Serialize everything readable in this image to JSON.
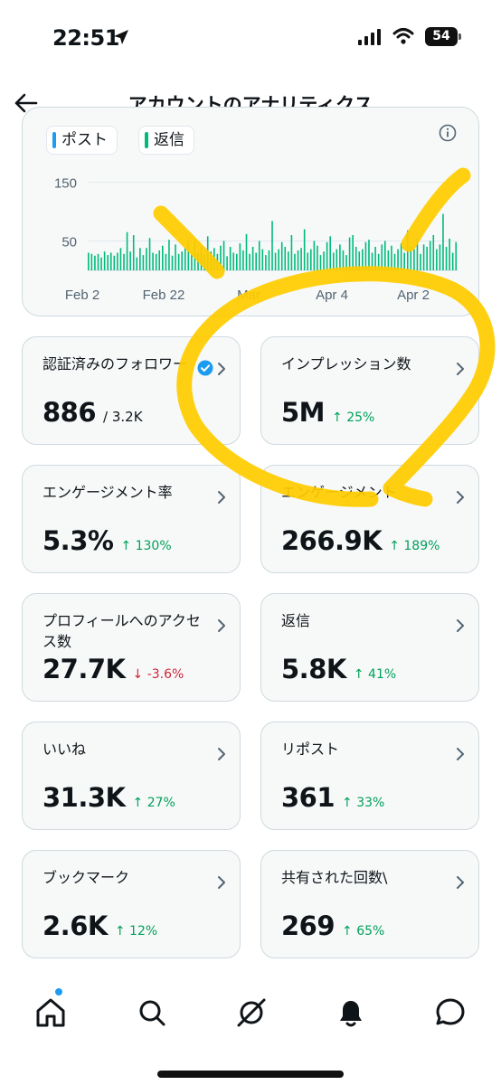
{
  "status_bar": {
    "time": "22:51",
    "battery": "54"
  },
  "header": {
    "title": "アカウントのアナリティクス"
  },
  "chart": {
    "legend": [
      {
        "label": "ポスト",
        "color": "#1d9bf0"
      },
      {
        "label": "返信",
        "color": "#00ba7c"
      }
    ]
  },
  "chart_data": {
    "type": "bar",
    "title": "",
    "x_ticks": [
      "Feb 2",
      "Feb 22",
      "Mar",
      "Apr 4",
      "Apr 2"
    ],
    "y_ticks": [
      150,
      50
    ],
    "ylim": [
      0,
      200
    ],
    "series": [
      {
        "name": "返信",
        "color": "#00ba7c",
        "values": [
          30,
          28,
          25,
          28,
          22,
          32,
          26,
          30,
          25,
          30,
          38,
          28,
          65,
          32,
          60,
          22,
          38,
          26,
          38,
          55,
          30,
          28,
          34,
          42,
          28,
          52,
          25,
          44,
          28,
          32,
          38,
          50,
          28,
          50,
          30,
          40,
          28,
          58,
          32,
          38,
          28,
          42,
          50,
          24,
          40,
          30,
          28,
          46,
          34,
          62,
          28,
          40,
          30,
          50,
          36,
          26,
          34,
          84,
          30,
          36,
          48,
          40,
          32,
          60,
          28,
          34,
          38,
          70,
          30,
          36,
          50,
          42,
          26,
          32,
          48,
          58,
          30,
          36,
          44,
          34,
          26,
          56,
          60,
          40,
          32,
          36,
          48,
          52,
          30,
          40,
          28,
          44,
          50,
          34,
          42,
          28,
          36,
          46,
          30,
          68,
          40,
          36,
          54,
          28,
          44,
          40,
          50,
          60,
          36,
          44,
          96,
          40,
          54,
          30,
          48
        ]
      }
    ]
  },
  "metrics": [
    {
      "label": "認証済みのフォロワー",
      "value": "886",
      "sub": "/ 3.2K",
      "change": "",
      "direction": ""
    },
    {
      "label": "インプレッション数",
      "value": "5M",
      "sub": "",
      "change": "↑ 25%",
      "direction": "up"
    },
    {
      "label": "エンゲージメント率",
      "value": "5.3%",
      "sub": "",
      "change": "↑ 130%",
      "direction": "up"
    },
    {
      "label": "エンゲージメント",
      "value": "266.9K",
      "sub": "",
      "change": "↑ 189%",
      "direction": "up"
    },
    {
      "label": "プロフィールへのアクセス数",
      "value": "27.7K",
      "sub": "",
      "change": "↓ -3.6%",
      "direction": "down"
    },
    {
      "label": "返信",
      "value": "5.8K",
      "sub": "",
      "change": "↑ 41%",
      "direction": "up"
    },
    {
      "label": "いいね",
      "value": "31.3K",
      "sub": "",
      "change": "↑ 27%",
      "direction": "up"
    },
    {
      "label": "リポスト",
      "value": "361",
      "sub": "",
      "change": "↑ 33%",
      "direction": "up"
    },
    {
      "label": "ブックマーク",
      "value": "2.6K",
      "sub": "",
      "change": "↑ 12%",
      "direction": "up"
    },
    {
      "label": "共有された回数\\",
      "value": "269",
      "sub": "",
      "change": "↑ 65%",
      "direction": "up"
    }
  ],
  "tabs": [
    {
      "name": "home-icon"
    },
    {
      "name": "search-icon"
    },
    {
      "name": "grok-icon"
    },
    {
      "name": "bell-icon"
    },
    {
      "name": "messages-icon"
    }
  ],
  "annotation": {
    "color": "#ffcc00"
  }
}
